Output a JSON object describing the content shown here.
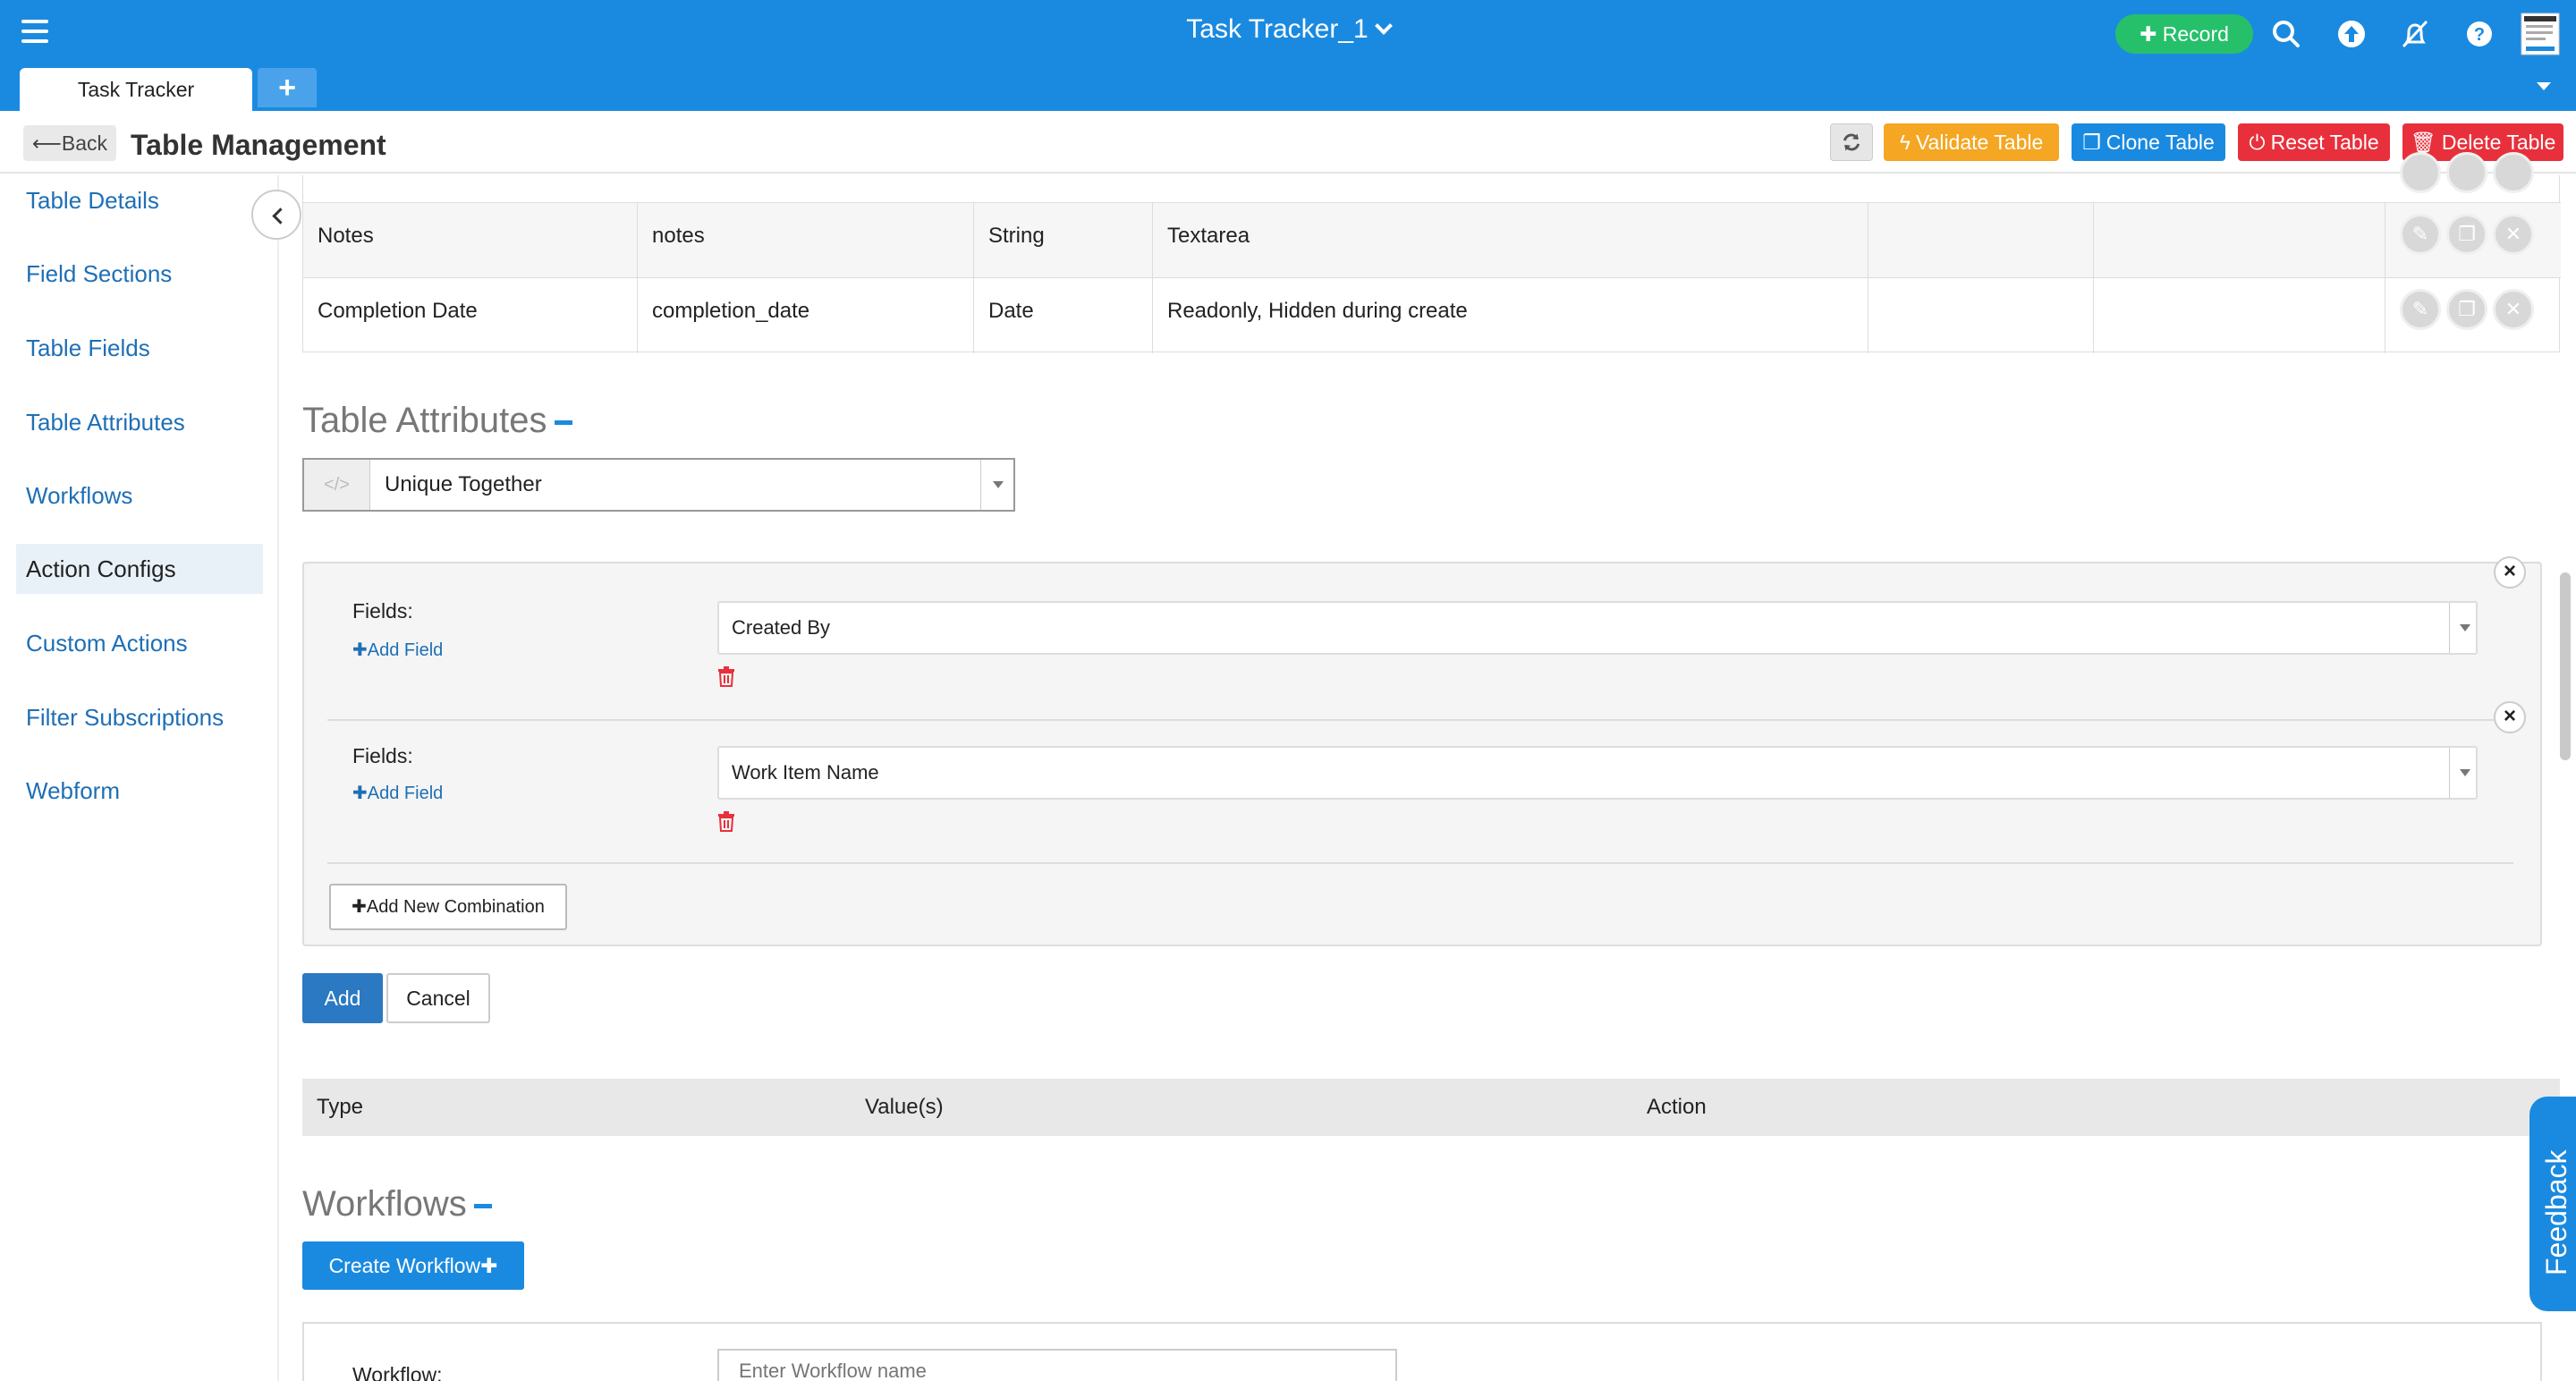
{
  "topbar": {
    "title": "Task Tracker_1",
    "record_label": "Record",
    "tab_label": "Task Tracker",
    "add_tab_label": "+"
  },
  "header": {
    "back_label": "Back",
    "page_title": "Table Management",
    "validate_label": "Validate Table",
    "clone_label": "Clone Table",
    "reset_label": "Reset Table",
    "delete_label": "Delete Table"
  },
  "sidebar": {
    "items": [
      {
        "label": "Table Details"
      },
      {
        "label": "Field Sections"
      },
      {
        "label": "Table Fields"
      },
      {
        "label": "Table Attributes"
      },
      {
        "label": "Workflows"
      },
      {
        "label": "Action Configs"
      },
      {
        "label": "Custom Actions"
      },
      {
        "label": "Filter Subscriptions"
      },
      {
        "label": "Webform"
      }
    ]
  },
  "fields_table": {
    "rows": [
      {
        "name": "Notes",
        "key": "notes",
        "type": "String",
        "widget": "Textarea"
      },
      {
        "name": "Completion Date",
        "key": "completion_date",
        "type": "Date",
        "widget": "Readonly, Hidden during create"
      }
    ]
  },
  "table_attributes": {
    "title": "Table Attributes",
    "selected_attribute": "Unique Together",
    "combinations": [
      {
        "label": "Fields:",
        "add_field": "Add Field",
        "value": "Created By"
      },
      {
        "label": "Fields:",
        "add_field": "Add Field",
        "value": "Work Item Name"
      }
    ],
    "add_combination_label": "Add New Combination",
    "add_label": "Add",
    "cancel_label": "Cancel",
    "columns": {
      "type": "Type",
      "values": "Value(s)",
      "action": "Action"
    }
  },
  "workflows": {
    "title": "Workflows",
    "create_label": "Create Workflow",
    "workflow_label": "Workflow:",
    "name_placeholder": "Enter Workflow name"
  },
  "feedback_label": "Feedback",
  "colors": {
    "brand_blue": "#1a8ae0",
    "record_green": "#26c06a",
    "validate_orange": "#f5a623",
    "clone_blue": "#1a8ae0",
    "reset_red": "#e8303c",
    "delete_red": "#e8303c"
  }
}
